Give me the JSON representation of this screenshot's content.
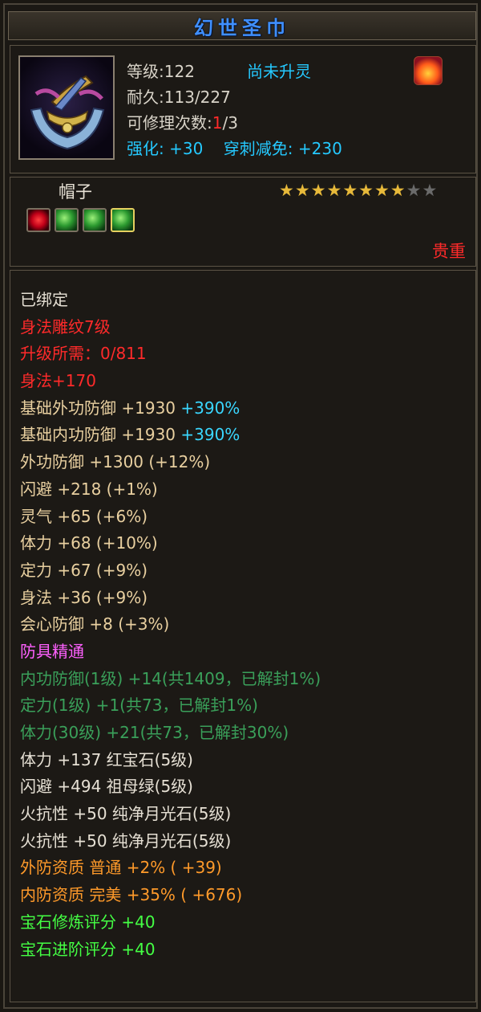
{
  "title": "幻世圣巾",
  "stats": {
    "level_label": "等级",
    "level_value": "122",
    "spirit_status": "尚未升灵",
    "durability_label": "耐久",
    "durability_value": "113/227",
    "repair_label": "可修理次数",
    "repair_current": "1",
    "repair_total": "/3",
    "enhance_label": "强化",
    "enhance_value": "+30",
    "pierce_label": "穿刺减免",
    "pierce_value": "+230"
  },
  "item_type": "帽子",
  "stars": {
    "filled": 8,
    "total": 10
  },
  "gems": [
    "ruby",
    "emerald",
    "emerald",
    "emerald"
  ],
  "rarity": "贵重",
  "properties": [
    {
      "segments": [
        {
          "text": "已绑定",
          "color": "white"
        }
      ]
    },
    {
      "segments": [
        {
          "text": "身法雕纹7级",
          "color": "red"
        }
      ]
    },
    {
      "segments": [
        {
          "text": "升级所需：0/811",
          "color": "red"
        }
      ]
    },
    {
      "segments": [
        {
          "text": "身法+170",
          "color": "red"
        }
      ]
    },
    {
      "segments": [
        {
          "text": "基础外功防御 +1930 ",
          "color": "tan"
        },
        {
          "text": "+390%",
          "color": "cyan"
        }
      ]
    },
    {
      "segments": [
        {
          "text": "基础内功防御 +1930 ",
          "color": "tan"
        },
        {
          "text": "+390%",
          "color": "cyan"
        }
      ]
    },
    {
      "segments": [
        {
          "text": "外功防御 +1300 (+12%)",
          "color": "tan"
        }
      ]
    },
    {
      "segments": [
        {
          "text": "闪避 +218 (+1%)",
          "color": "tan"
        }
      ]
    },
    {
      "segments": [
        {
          "text": "灵气 +65 (+6%)",
          "color": "tan"
        }
      ]
    },
    {
      "segments": [
        {
          "text": "体力 +68 (+10%)",
          "color": "tan"
        }
      ]
    },
    {
      "segments": [
        {
          "text": "定力 +67 (+9%)",
          "color": "tan"
        }
      ]
    },
    {
      "segments": [
        {
          "text": "身法 +36 (+9%)",
          "color": "tan"
        }
      ]
    },
    {
      "segments": [
        {
          "text": "会心防御 +8 (+3%)",
          "color": "tan"
        }
      ]
    },
    {
      "segments": [
        {
          "text": "防具精通",
          "color": "pink"
        }
      ]
    },
    {
      "segments": [
        {
          "text": "内功防御(1级) +14(共1409，已解封1%)",
          "color": "green"
        }
      ]
    },
    {
      "segments": [
        {
          "text": "定力(1级) +1(共73，已解封1%)",
          "color": "green"
        }
      ]
    },
    {
      "segments": [
        {
          "text": "体力(30级) +21(共73，已解封30%)",
          "color": "green"
        }
      ]
    },
    {
      "segments": [
        {
          "text": "体力 +137 红宝石(5级)",
          "color": "white"
        }
      ]
    },
    {
      "segments": [
        {
          "text": "闪避 +494 祖母绿(5级)",
          "color": "white"
        }
      ]
    },
    {
      "segments": [
        {
          "text": "火抗性 +50 纯净月光石(5级)",
          "color": "white"
        }
      ]
    },
    {
      "segments": [
        {
          "text": "火抗性 +50 纯净月光石(5级)",
          "color": "white"
        }
      ]
    },
    {
      "segments": [
        {
          "text": "外防资质  普通 +2% ( +39)",
          "color": "orange"
        }
      ]
    },
    {
      "segments": [
        {
          "text": "内防资质  完美 +35% ( +676)",
          "color": "orange"
        }
      ]
    },
    {
      "segments": [
        {
          "text": "宝石修炼评分 +40",
          "color": "lime"
        }
      ]
    },
    {
      "segments": [
        {
          "text": "宝石进阶评分 +40",
          "color": "lime"
        }
      ]
    }
  ],
  "icons": {
    "item_icon": "headband-icon",
    "spirit_icon": "flame-icon"
  }
}
